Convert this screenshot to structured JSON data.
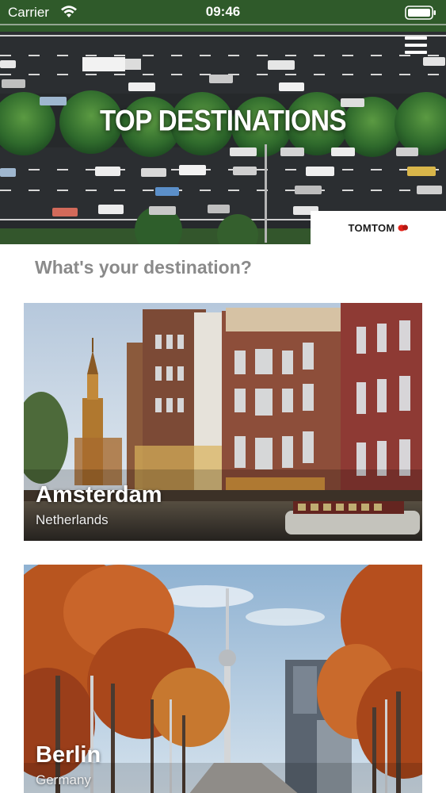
{
  "status_bar": {
    "carrier": "Carrier",
    "time": "09:46",
    "icons": [
      "wifi-icon",
      "battery-icon"
    ]
  },
  "hero": {
    "title": "TOP DESTINATIONS",
    "menu_icon": "hamburger-menu-icon",
    "brand": "TOMTOM",
    "brand_mark": "tomtom-hands-logo"
  },
  "question": "What's your destination?",
  "destinations": [
    {
      "city": "Amsterdam",
      "country": "Netherlands"
    },
    {
      "city": "Berlin",
      "country": "Germany"
    }
  ],
  "colors": {
    "road": "#2a2d30",
    "tree": "#3f7f35",
    "question_text": "#8a8a8a",
    "brand_red": "#e2231a"
  }
}
